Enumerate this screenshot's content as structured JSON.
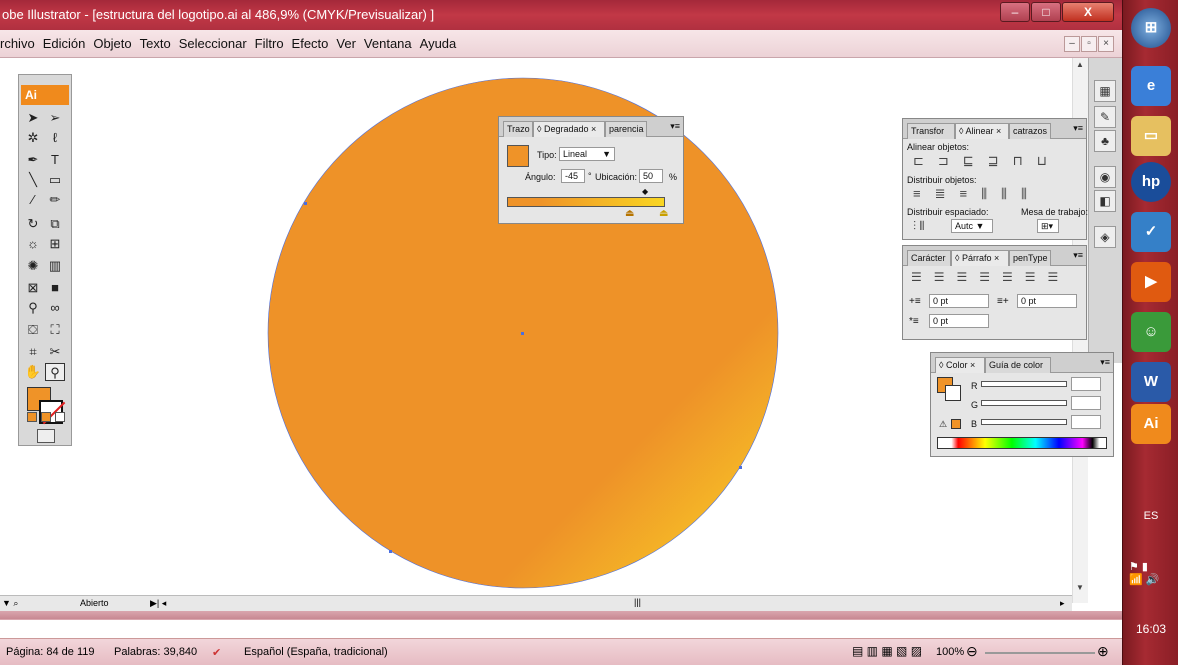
{
  "window": {
    "title": "obe Illustrator - [estructura del logotipo.ai al 486,9% (CMYK/Previsualizar) ]",
    "min_label": "–",
    "max_label": "□",
    "close_label": "X"
  },
  "menubar": {
    "items": [
      "rchivo",
      "Edición",
      "Objeto",
      "Texto",
      "Seleccionar",
      "Filtro",
      "Efecto",
      "Ver",
      "Ventana",
      "Ayuda"
    ]
  },
  "tools": {
    "logo": "Ai",
    "fill_color": "#ef9328"
  },
  "gradient_panel": {
    "tabs": [
      "Trazo",
      "Degradado",
      "parencia"
    ],
    "tipo_label": "Tipo:",
    "tipo_value": "Lineal",
    "angulo_label": "Ángulo:",
    "angulo_value": "-45",
    "angulo_unit": "°",
    "ubicacion_label": "Ubicación:",
    "ubicacion_value": "50",
    "ubicacion_unit": "%",
    "start_color": "#ef9328",
    "end_color": "#f9d623"
  },
  "align_panel": {
    "tabs": [
      "Transfor",
      "Alinear",
      "catrazos"
    ],
    "alinear_objetos": "Alinear objetos:",
    "distribuir_objetos": "Distribuir objetos:",
    "distribuir_espaciado": "Distribuir espaciado:",
    "mesa_trabajo": "Mesa de trabajo:",
    "auto_value": "Autc"
  },
  "paragraph_panel": {
    "tabs": [
      "Carácter",
      "Párrafo",
      "penType"
    ],
    "indent_left": "0 pt",
    "indent_right": "0 pt",
    "indent_first": "0 pt"
  },
  "color_panel": {
    "tabs": [
      "Color",
      "Guía de color"
    ],
    "r_label": "R",
    "g_label": "G",
    "b_label": "B"
  },
  "ai_status": {
    "state": "Abierto"
  },
  "word_status": {
    "page": "Página: 84 de 119",
    "words": "Palabras: 39,840",
    "language": "Español (España, tradicional)",
    "zoom": "100%"
  },
  "taskbar": {
    "lang": "ES",
    "clock": "16:03",
    "ai_label": "Ai"
  },
  "artwork": {
    "circle_start": "#ee9228",
    "circle_end": "#fbd826",
    "path_color": "#4a6ee0"
  }
}
